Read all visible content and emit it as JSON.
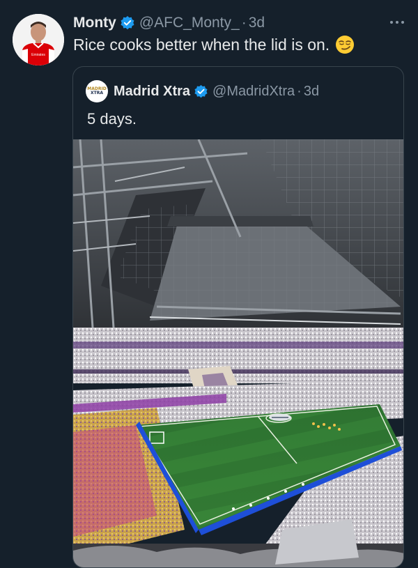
{
  "tweet": {
    "author": {
      "display_name": "Monty",
      "handle": "@AFC_Monty_",
      "time": "3d",
      "separator": "·",
      "avatar_shirt_text": "Emirates"
    },
    "text": "Rice cooks better when the lid is on.",
    "emoji": "smirking-face-emoji",
    "more_icon": "more-options-icon"
  },
  "quote": {
    "author": {
      "display_name": "Madrid Xtra",
      "handle": "@MadridXtra",
      "time": "3d",
      "separator": "·",
      "logo_text_top": "MADRID",
      "logo_text_bottom": "XTRA"
    },
    "text": "5 days.",
    "media": {
      "type": "photo",
      "subject": "stadium-interior-with-retractable-roof"
    }
  },
  "colors": {
    "background": "#15202b",
    "primary_text": "#e7e9ea",
    "secondary_text": "#8b98a5",
    "border": "#38444d",
    "verified_blue": "#1d9bf0",
    "arsenal_red": "#db0007"
  }
}
